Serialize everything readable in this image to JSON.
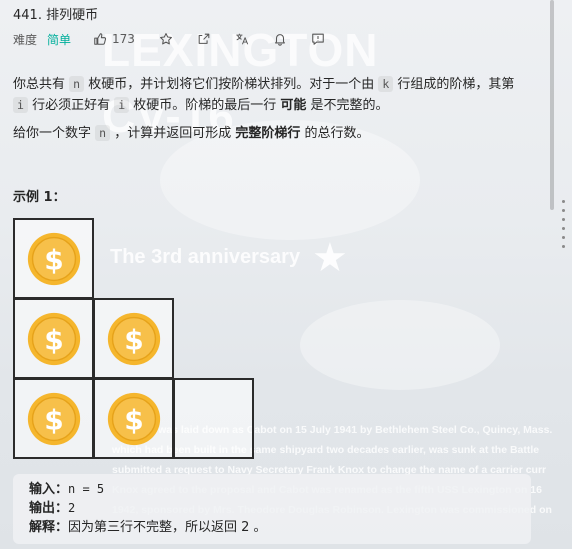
{
  "problem": {
    "title": "441. 排列硬币",
    "difficulty_label": "难度",
    "difficulty": "简单",
    "like_count": "173",
    "icons": [
      "thumbs-up-icon",
      "star-icon",
      "share-icon",
      "translate-icon",
      "bell-icon",
      "feedback-icon"
    ]
  },
  "description": {
    "p1": {
      "t1": "你总共有 ",
      "c1": "n",
      "t2": " 枚硬币，并计划将它们按阶梯状排列。对于一个由 ",
      "c2": "k",
      "t3": " 行组成的阶梯，其第",
      "c3": "i",
      "t4": " 行必须正好有 ",
      "c4": "i",
      "t5": " 枚硬币。阶梯的最后一行 ",
      "b1": "可能",
      "t6": " 是不完整的。"
    },
    "p2": {
      "t1": "给你一个数字 ",
      "c1": "n",
      "t2": " ，计算并返回可形成 ",
      "b1": "完整阶梯行",
      "t3": " 的总行数。"
    }
  },
  "example": {
    "title": "示例 1：",
    "coin_rows": [
      1,
      2,
      2
    ],
    "input_label": "输入：",
    "input_value": "n = 5",
    "output_label": "输出：",
    "output_value": "2",
    "explain_label": "解释：",
    "explain_text": "因为第三行不完整，所以返回 2 。"
  },
  "background": {
    "big_text_1": "LEXINGTON",
    "big_text_2": "CV-16",
    "anniversary": "The 3rd anniversary",
    "lines": [
      "The ship was laid down as Cabot on 15 July 1941 by Bethlehem Steel Co., Quincy, Mass.",
      "which had been built in the same shipyard two decades earlier, was sunk at the Battle",
      "submitted a request to Navy Secretary Frank Knox to change the name of a carrier curr",
      "Knox agreed to the proposal and Cabot was renamed as the fifth USS Lexington on 16",
      "1942, sponsored by Mrs. Theodore Douglas Robinson. Lexington was commissioned on"
    ]
  },
  "colors": {
    "easy": "#00af9b",
    "coin": "#f5b62d",
    "text": "#262626"
  }
}
